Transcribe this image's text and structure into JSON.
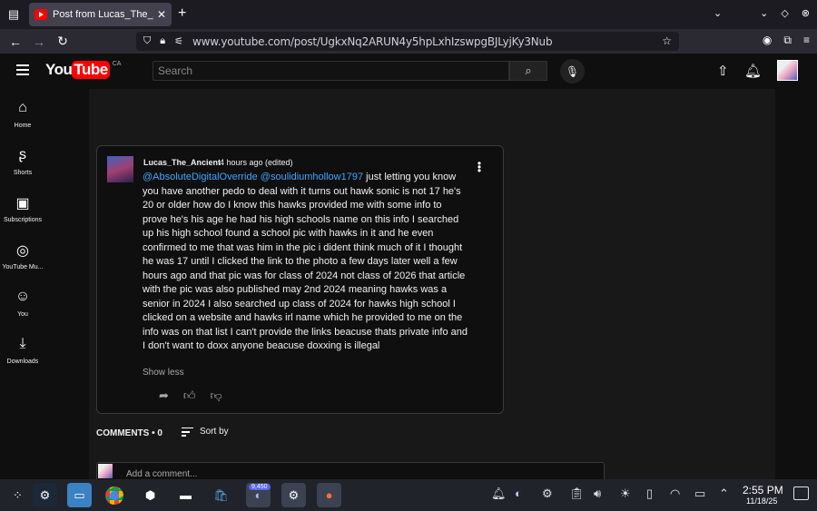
{
  "browser": {
    "tab_title": "Post from Lucas_The_Ancient",
    "url": "www.youtube.com/post/UgkxNq2ARUN4y5hpLxhIzswpgBJLyjKy3Nub",
    "new_tab": "+",
    "tab_close": "✕"
  },
  "youtube": {
    "logo_you": "You",
    "logo_tube": "Tube",
    "country": "CA",
    "search_placeholder": "Search"
  },
  "sidebar": {
    "items": [
      {
        "label": "Home",
        "icon": "home-icon"
      },
      {
        "label": "Shorts",
        "icon": "shorts-icon"
      },
      {
        "label": "Subscriptions",
        "icon": "subscriptions-icon"
      },
      {
        "label": "YouTube Mu...",
        "icon": "youtube-music-icon"
      },
      {
        "label": "You",
        "icon": "you-icon"
      },
      {
        "label": "Downloads",
        "icon": "downloads-icon"
      }
    ]
  },
  "comment": {
    "author": "Lucas_The_Ancient",
    "time": "4 hours ago (edited)",
    "mention1": "@AbsoluteDigitalOverride",
    "mention2": "@soulidiumhollow1797",
    "body": " just letting you know you have another pedo to deal with it turns out hawk sonic is not 17 he's 20 or older how do I know this hawks provided me with some info to prove he's his age he had his high schools name on this info I searched up his high school found a school pic with hawks in it and he even confirmed to me that was him in the pic i dident think much of it I thought he was 17 until I clicked the link to the photo a few days later well a few hours ago and that pic was for class of 2024 not class of 2026 that article with the pic was also published may 2nd 2024 meaning hawks was a senior in 2024 I also searched up class of 2024 for hawks high school I clicked on a website and hawks irl name which he provided to me on the info was on that list I can't provide the links beacuse thats private info and I don't want to doxx anyone beacuse doxxing is illegal",
    "show_less": "Show less"
  },
  "comments_section": {
    "title": "COMMENTS • 0",
    "sort_label": "Sort by",
    "add_placeholder": "Add a comment..."
  },
  "taskbar": {
    "discord_badge": "9,450",
    "clock_time": "2:55 PM",
    "clock_date": "11/18/25"
  },
  "colors": {
    "mention": "#3ea6ff",
    "youtube_red": "#ff0000",
    "background": "#0f0f0f"
  }
}
